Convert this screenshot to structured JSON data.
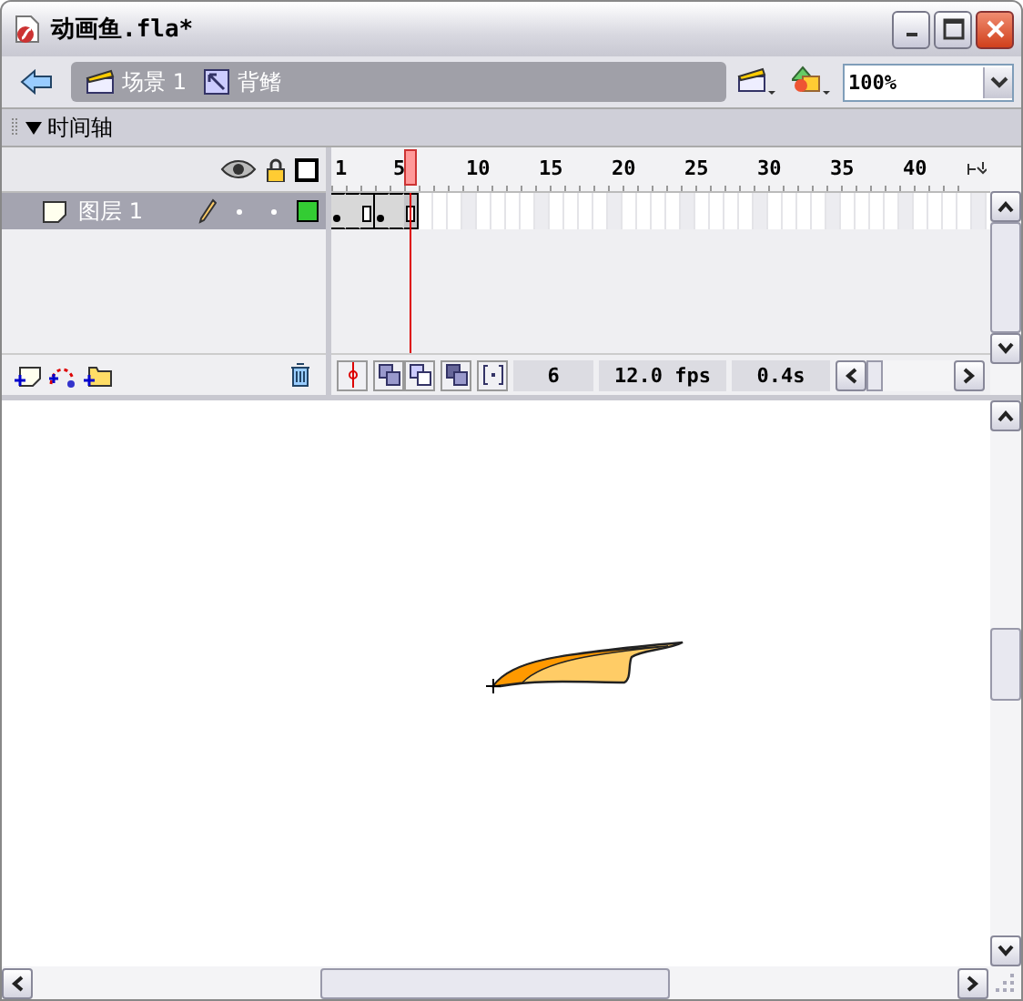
{
  "window": {
    "title": "动画鱼.fla*"
  },
  "breadcrumb": [
    {
      "kind": "scene",
      "label": "场景 1"
    },
    {
      "kind": "symbol",
      "label": "背鳍"
    }
  ],
  "zoom": {
    "value": "100%"
  },
  "timeline": {
    "title": "时间轴",
    "expanded": true,
    "ruler": [
      "1",
      "5",
      "10",
      "15",
      "20",
      "25",
      "30",
      "35",
      "40"
    ],
    "layers": [
      {
        "name": "图层 1",
        "selected": true,
        "color": "#33cc33",
        "frames": [
          {
            "kind": "key",
            "selected": false
          },
          {
            "kind": "plain",
            "selected": false
          },
          {
            "kind": "end",
            "selected": false
          },
          {
            "kind": "key",
            "selected": false
          },
          {
            "kind": "plain",
            "selected": false
          },
          {
            "kind": "end",
            "selected": true
          }
        ]
      }
    ],
    "status": {
      "frame": "6",
      "fps": "12.0 fps",
      "time": "0.4s"
    }
  }
}
